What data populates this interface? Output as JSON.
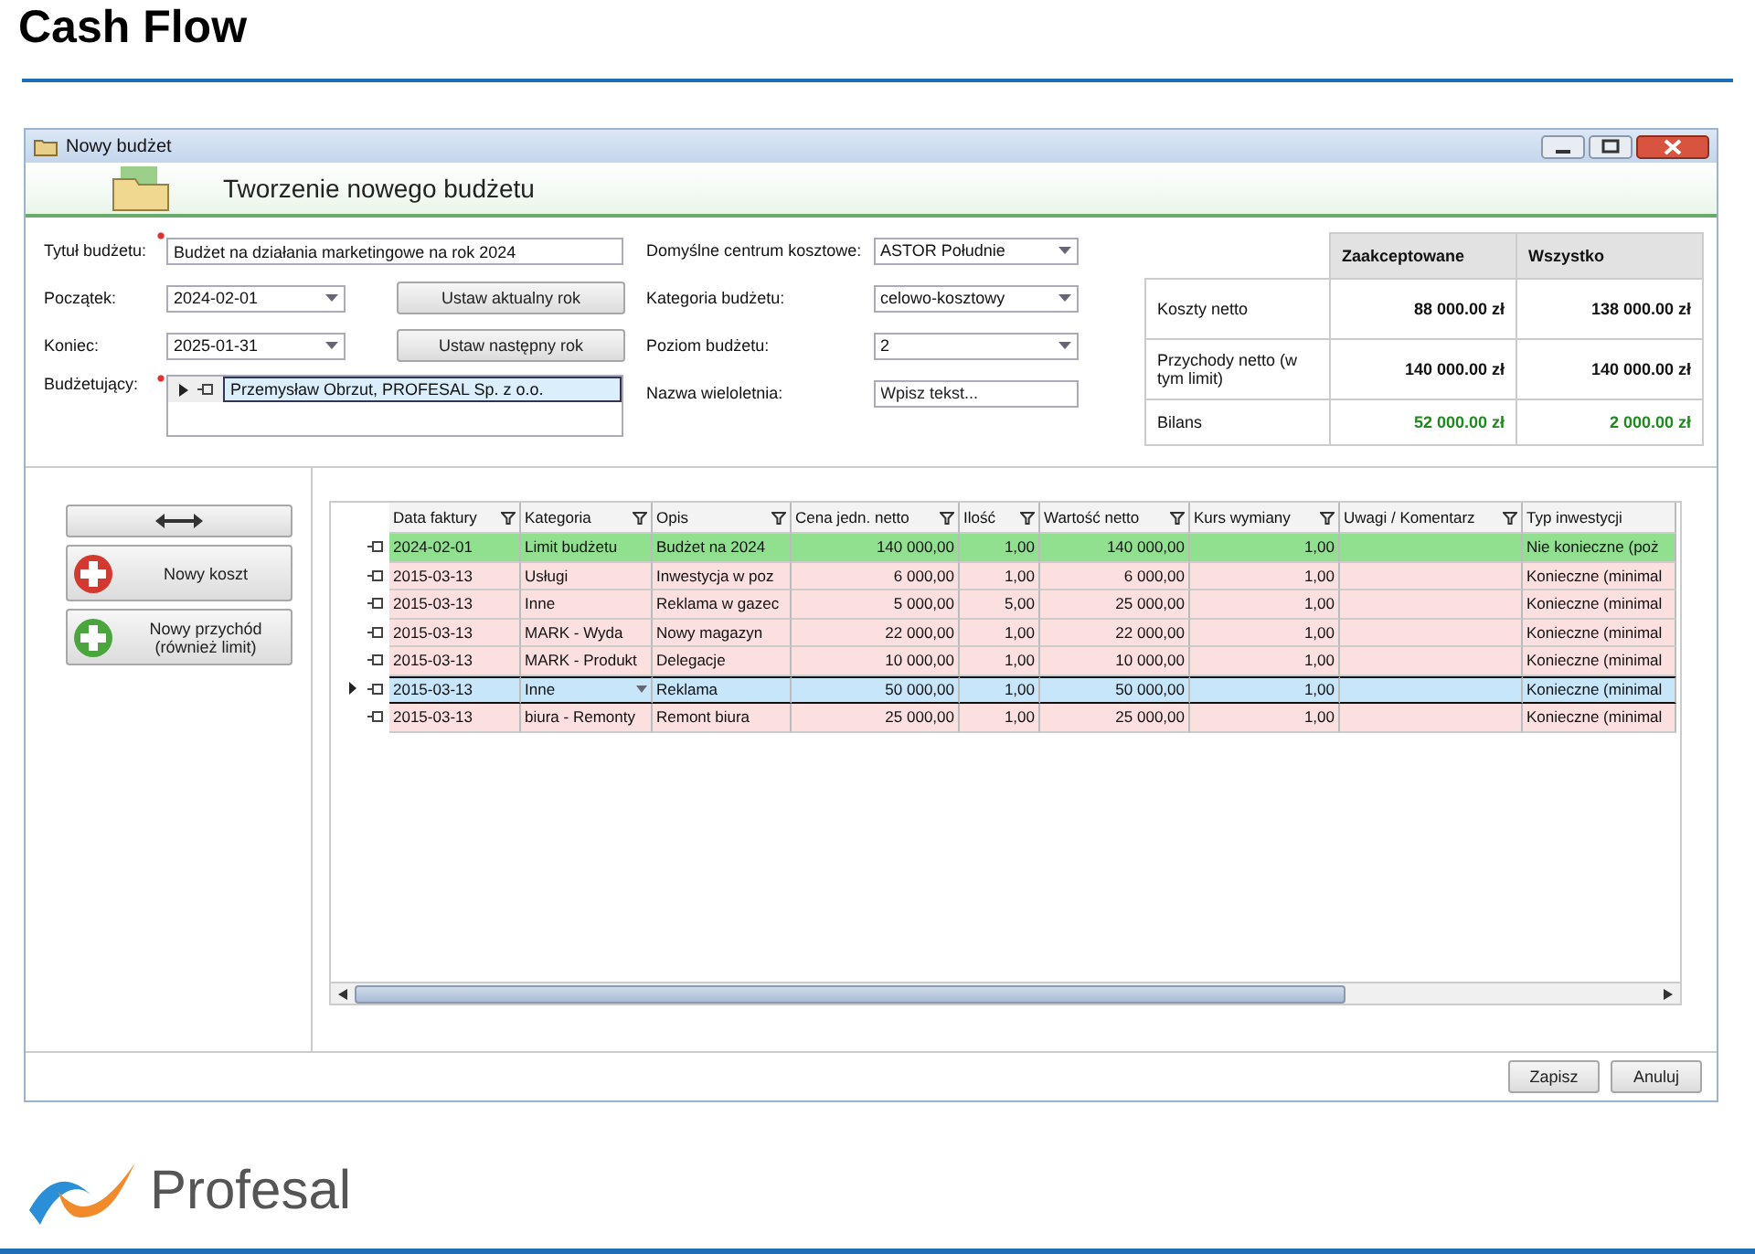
{
  "slide": {
    "title": "Cash Flow",
    "logo_text": "Profesal"
  },
  "window": {
    "title": "Nowy budżet",
    "header": "Tworzenie nowego budżetu"
  },
  "form_left": [
    {
      "kind": "text",
      "label": "Tytuł budżetu:",
      "value": "Budżet na działania marketingowe na rok 2024",
      "required": true
    },
    {
      "kind": "date",
      "label": "Początek:",
      "value": "2024-02-01",
      "button": "Ustaw aktualny rok"
    },
    {
      "kind": "date",
      "label": "Koniec:",
      "value": "2025-01-31",
      "button": "Ustaw następny rok"
    },
    {
      "kind": "list",
      "label": "Budżetujący:",
      "value": "Przemysław Obrzut, PROFESAL Sp. z o.o.",
      "required": true
    }
  ],
  "form_middle": [
    {
      "kind": "combo",
      "label": "Domyślne centrum kosztowe:",
      "value": "ASTOR Południe"
    },
    {
      "kind": "combo",
      "label": "Kategoria budżetu:",
      "value": "celowo-kosztowy"
    },
    {
      "kind": "combo",
      "label": "Poziom budżetu:",
      "value": "2"
    },
    {
      "kind": "text",
      "label": "Nazwa wieloletnia:",
      "placeholder": "Wpisz tekst..."
    }
  ],
  "summary": {
    "columns": [
      "Zaakceptowane",
      "Wszystko"
    ],
    "rows": [
      {
        "label": "Koszty netto",
        "values": [
          "88 000.00 zł",
          "138 000.00 zł"
        ],
        "positive": false
      },
      {
        "label": "Przychody netto (w tym limit)",
        "values": [
          "140 000.00 zł",
          "140 000.00 zł"
        ],
        "positive": false
      },
      {
        "label": "Bilans",
        "values": [
          "52 000.00 zł",
          "2 000.00 zł"
        ],
        "positive": true
      }
    ]
  },
  "side_buttons": [
    {
      "kind": "swap"
    },
    {
      "kind": "cost",
      "label": "Nowy koszt"
    },
    {
      "kind": "income",
      "label": "Nowy przychód (również limit)"
    }
  ],
  "grid": {
    "columns": [
      {
        "label": "Data faktury",
        "filter": true
      },
      {
        "label": "Kategoria",
        "filter": true
      },
      {
        "label": "Opis",
        "filter": true
      },
      {
        "label": "Cena jedn. netto",
        "filter": true
      },
      {
        "label": "Ilość",
        "filter": true
      },
      {
        "label": "Wartość netto",
        "filter": true
      },
      {
        "label": "Kurs wymiany",
        "filter": true
      },
      {
        "label": "Uwagi / Komentarz",
        "filter": true
      },
      {
        "label": "Typ inwestycji",
        "filter": false
      }
    ],
    "rows": [
      {
        "date": "2024-02-01",
        "category": "Limit budżetu",
        "description": "Budżet na 2024",
        "unit_price": "140 000,00",
        "quantity": "1,00",
        "net_value": "140 000,00",
        "exchange_rate": "1,00",
        "investment_type": "Nie konieczne (poż",
        "color": "#90e090",
        "selected": false
      },
      {
        "date": "2015-03-13",
        "category": "Usługi",
        "description": "Inwestycja w poz",
        "unit_price": "6 000,00",
        "quantity": "1,00",
        "net_value": "6 000,00",
        "exchange_rate": "1,00",
        "investment_type": "Konieczne (minimal",
        "color": "#fce0e0",
        "selected": false
      },
      {
        "date": "2015-03-13",
        "category": "Inne",
        "description": "Reklama w gazec",
        "unit_price": "5 000,00",
        "quantity": "5,00",
        "net_value": "25 000,00",
        "exchange_rate": "1,00",
        "investment_type": "Konieczne (minimal",
        "color": "#fce0e0",
        "selected": false
      },
      {
        "date": "2015-03-13",
        "category": "MARK  - Wyda",
        "description": "Nowy magazyn",
        "unit_price": "22 000,00",
        "quantity": "1,00",
        "net_value": "22 000,00",
        "exchange_rate": "1,00",
        "investment_type": "Konieczne (minimal",
        "color": "#fce0e0",
        "selected": false
      },
      {
        "date": "2015-03-13",
        "category": "MARK - Produkt",
        "description": "Delegacje",
        "unit_price": "10 000,00",
        "quantity": "1,00",
        "net_value": "10 000,00",
        "exchange_rate": "1,00",
        "investment_type": "Konieczne (minimal",
        "color": "#fce0e0",
        "selected": false
      },
      {
        "date": "2015-03-13",
        "category": "Inne",
        "description": "Reklama",
        "unit_price": "50 000,00",
        "quantity": "1,00",
        "net_value": "50 000,00",
        "exchange_rate": "1,00",
        "investment_type": "Konieczne (minimal",
        "selected": true
      },
      {
        "date": "2015-03-13",
        "category": "biura - Remonty",
        "description": "Remont biura",
        "unit_price": "25 000,00",
        "quantity": "1,00",
        "net_value": "25 000,00",
        "exchange_rate": "1,00",
        "investment_type": "Konieczne (minimal",
        "color": "#fce0e0",
        "selected": false
      }
    ]
  },
  "footer_buttons": [
    "Zapisz",
    "Anuluj"
  ]
}
